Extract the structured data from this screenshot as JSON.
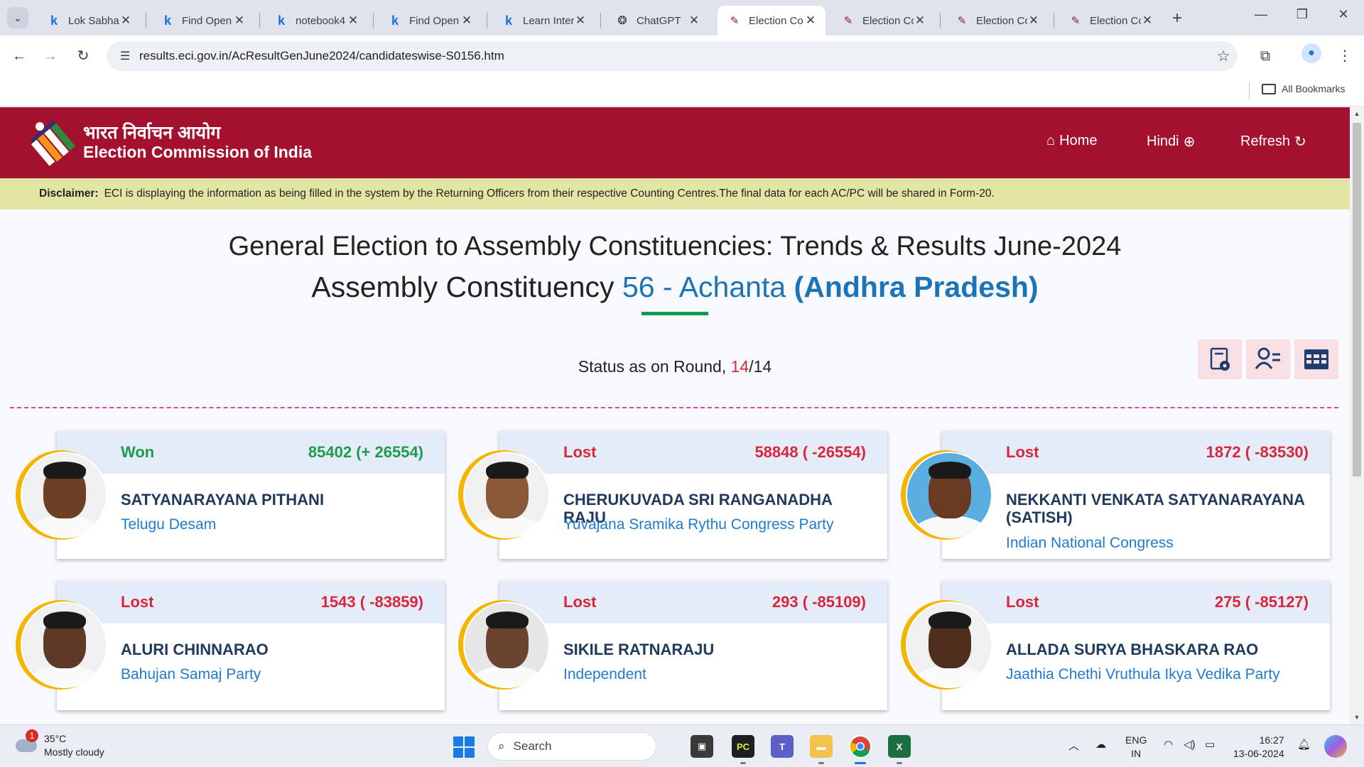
{
  "browser": {
    "tabs": [
      {
        "title": "Lok Sabha",
        "icon": "kaggle-icon"
      },
      {
        "title": "Find Open",
        "icon": "kaggle-icon"
      },
      {
        "title": "notebook4",
        "icon": "kaggle-icon"
      },
      {
        "title": "Find Open",
        "icon": "kaggle-icon"
      },
      {
        "title": "Learn Inter",
        "icon": "kaggle-icon"
      },
      {
        "title": "ChatGPT",
        "icon": "chatgpt-icon"
      },
      {
        "title": "Election Co",
        "icon": "eci-icon",
        "active": true
      },
      {
        "title": "Election Co",
        "icon": "eci-icon"
      },
      {
        "title": "Election Co",
        "icon": "eci-icon"
      },
      {
        "title": "Election Co",
        "icon": "eci-icon"
      }
    ],
    "url": "results.eci.gov.in/AcResultGenJune2024/candidateswise-S0156.htm",
    "bookmarks_label": "All Bookmarks"
  },
  "header": {
    "org_hindi": "भारत निर्वाचन आयोग",
    "org_english": "Election Commission of India",
    "nav": {
      "home": "Home",
      "hindi": "Hindi",
      "refresh": "Refresh"
    },
    "brand_color": "#a3112f"
  },
  "disclaimer": {
    "label": "Disclaimer:",
    "text": "ECI is displaying the information as being filled in the system by the Returning Officers from their respective Counting Centres.The final data for each AC/PC will be shared in Form-20."
  },
  "main": {
    "title": "General Election to Assembly Constituencies: Trends & Results June-2024",
    "subtitle_prefix": "Assembly Constituency",
    "constituency": "56 - Achanta",
    "state": "(Andhra Pradesh)",
    "status_label": "Status as on Round,",
    "round_current": "14",
    "round_sep": "/",
    "round_total": "14"
  },
  "candidates": [
    {
      "status": "Won",
      "votes": "85402 (+ 26554)",
      "name": "SATYANARAYANA PITHANI",
      "party": "Telugu Desam"
    },
    {
      "status": "Lost",
      "votes": "58848 ( -26554)",
      "name": "CHERUKUVADA SRI RANGANADHA RAJU",
      "party": "Yuvajana Sramika Rythu Congress Party"
    },
    {
      "status": "Lost",
      "votes": "1872 ( -83530)",
      "name": "NEKKANTI VENKATA SATYANARAYANA (SATISH)",
      "party": "Indian National Congress"
    },
    {
      "status": "Lost",
      "votes": "1543 ( -83859)",
      "name": "ALURI CHINNARAO",
      "party": "Bahujan Samaj Party"
    },
    {
      "status": "Lost",
      "votes": "293 ( -85109)",
      "name": "SIKILE RATNARAJU",
      "party": "Independent"
    },
    {
      "status": "Lost",
      "votes": "275 ( -85127)",
      "name": "ALLADA SURYA BHASKARA RAO",
      "party": "Jaathia Chethi Vruthula Ikya Vedika Party"
    }
  ],
  "taskbar": {
    "weather_badge": "1",
    "weather_temp": "35°C",
    "weather_desc": "Mostly cloudy",
    "search_label": "Search",
    "lang_line1": "ENG",
    "lang_line2": "IN",
    "time": "16:27",
    "date": "13-06-2024"
  }
}
